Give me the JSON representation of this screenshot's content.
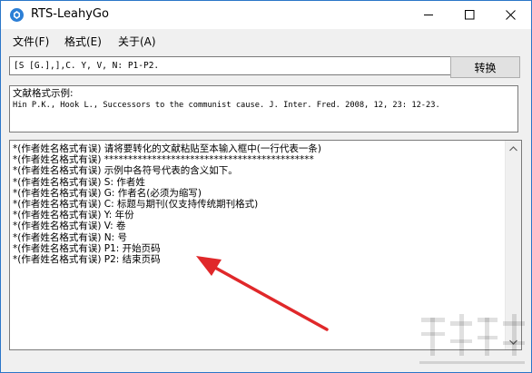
{
  "window": {
    "title": "RTS-LeahyGo"
  },
  "menu": [
    {
      "label": "文件(F)"
    },
    {
      "label": "格式(E)"
    },
    {
      "label": "关于(A)"
    }
  ],
  "format_input": {
    "value": "[S [G.],],C. Y, V, N: P1-P2."
  },
  "convert_button": {
    "label": "转换"
  },
  "example": {
    "label": "文献格式示例:",
    "text": "Hin P.K., Hook L., Successors to the communist cause. J. Inter. Fred. 2008, 12, 23: 12-23."
  },
  "main_text": {
    "lines": [
      "*(作者姓名格式有误) 请将要转化的文献粘贴至本输入框中(一行代表一条)",
      "*(作者姓名格式有误) ********************************************",
      "*(作者姓名格式有误) 示例中各符号代表的含义如下。",
      "*(作者姓名格式有误) S: 作者姓",
      "*(作者姓名格式有误) G: 作者名(必须为缩写)",
      "*(作者姓名格式有误) C: 标题与期刊(仅支持传统期刊格式)",
      "*(作者姓名格式有误) Y: 年份",
      "*(作者姓名格式有误) V: 卷",
      "*(作者姓名格式有误) N: 号",
      "*(作者姓名格式有误) P1: 开始页码",
      "*(作者姓名格式有误) P2: 结束页码"
    ]
  },
  "colors": {
    "annotation_arrow": "#e0282a",
    "window_border": "#2b76c8",
    "app_icon": "#2c7fd6"
  },
  "icons": {
    "app": "app-logo-icon",
    "minimize": "minimize-icon",
    "maximize": "maximize-icon",
    "close": "close-icon"
  }
}
